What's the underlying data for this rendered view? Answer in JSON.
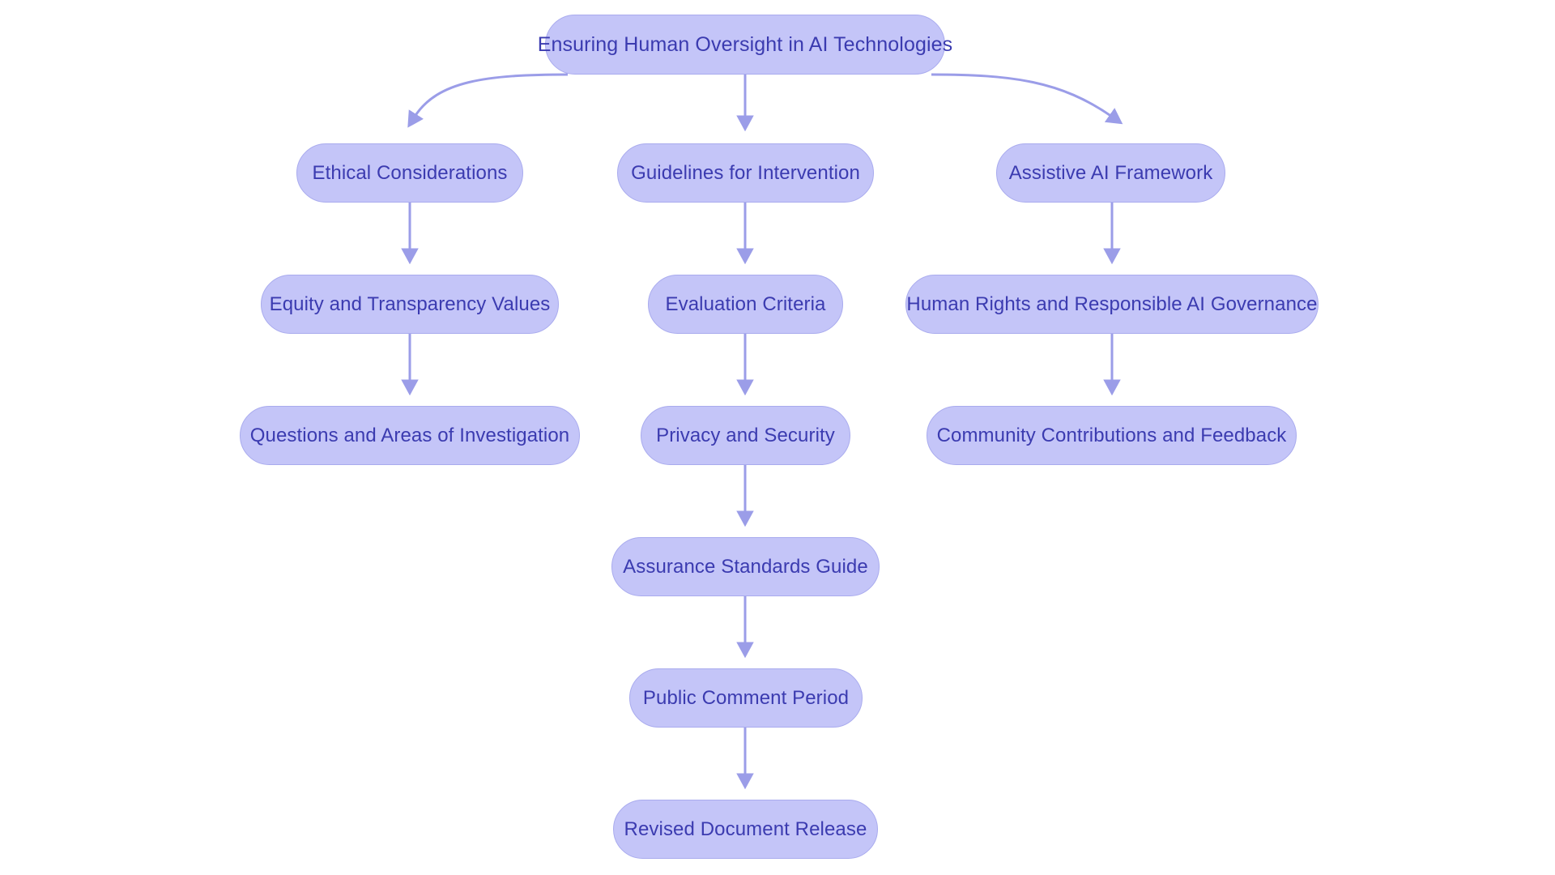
{
  "diagram": {
    "type": "flowchart",
    "orientation": "top-down",
    "background_color": "#ffffff",
    "node_fill_color": "#c4c5f8",
    "node_border_color": "#a9abee",
    "node_text_color": "#3b3bb0",
    "edge_color": "#9b9de8",
    "title": "Ensuring Human Oversight in AI Technologies"
  },
  "nodes": {
    "root": {
      "id": "root",
      "label": "Ensuring Human Oversight in AI Technologies"
    },
    "ethical_considerations": {
      "id": "ethical_considerations",
      "label": "Ethical Considerations"
    },
    "guidelines_for_intervention": {
      "id": "guidelines_for_intervention",
      "label": "Guidelines for Intervention"
    },
    "assistive_ai_framework": {
      "id": "assistive_ai_framework",
      "label": "Assistive AI Framework"
    },
    "equity_and_transparency_values": {
      "id": "equity_and_transparency_values",
      "label": "Equity and Transparency Values"
    },
    "evaluation_criteria": {
      "id": "evaluation_criteria",
      "label": "Evaluation Criteria"
    },
    "human_rights_and_governance": {
      "id": "human_rights_and_governance",
      "label": "Human Rights and Responsible AI Governance"
    },
    "questions_and_areas": {
      "id": "questions_and_areas",
      "label": "Questions and Areas of Investigation"
    },
    "privacy_and_security": {
      "id": "privacy_and_security",
      "label": "Privacy and Security"
    },
    "community_contributions": {
      "id": "community_contributions",
      "label": "Community Contributions and Feedback"
    },
    "assurance_standards_guide": {
      "id": "assurance_standards_guide",
      "label": "Assurance Standards Guide"
    },
    "public_comment_period": {
      "id": "public_comment_period",
      "label": "Public Comment Period"
    },
    "revised_document_release": {
      "id": "revised_document_release",
      "label": "Revised Document Release"
    }
  },
  "edges": [
    {
      "from": "root",
      "to": "ethical_considerations",
      "style": "curved"
    },
    {
      "from": "root",
      "to": "guidelines_for_intervention",
      "style": "straight"
    },
    {
      "from": "root",
      "to": "assistive_ai_framework",
      "style": "curved"
    },
    {
      "from": "ethical_considerations",
      "to": "equity_and_transparency_values",
      "style": "straight"
    },
    {
      "from": "guidelines_for_intervention",
      "to": "evaluation_criteria",
      "style": "straight"
    },
    {
      "from": "assistive_ai_framework",
      "to": "human_rights_and_governance",
      "style": "straight"
    },
    {
      "from": "equity_and_transparency_values",
      "to": "questions_and_areas",
      "style": "straight"
    },
    {
      "from": "evaluation_criteria",
      "to": "privacy_and_security",
      "style": "straight"
    },
    {
      "from": "human_rights_and_governance",
      "to": "community_contributions",
      "style": "straight"
    },
    {
      "from": "privacy_and_security",
      "to": "assurance_standards_guide",
      "style": "straight"
    },
    {
      "from": "assurance_standards_guide",
      "to": "public_comment_period",
      "style": "straight"
    },
    {
      "from": "public_comment_period",
      "to": "revised_document_release",
      "style": "straight"
    }
  ]
}
